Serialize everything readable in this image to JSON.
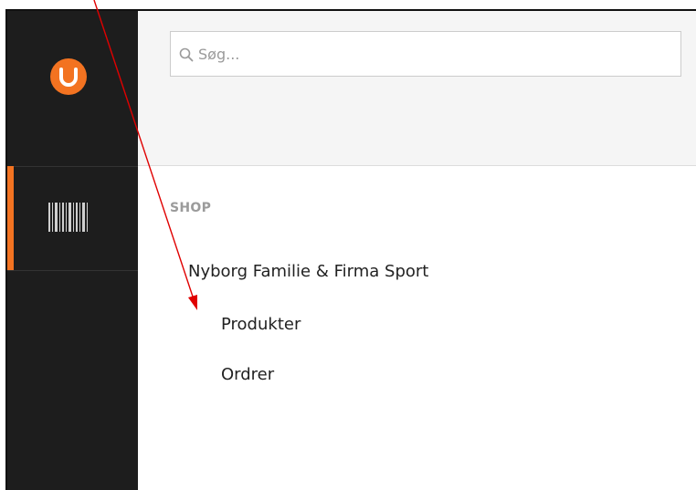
{
  "sidebar": {
    "logo_icon": "umbraco-logo-icon",
    "sections": [
      {
        "icon": "barcode-icon",
        "active": true
      }
    ]
  },
  "search": {
    "placeholder": "Søg...",
    "value": "",
    "icon": "search-icon"
  },
  "tree": {
    "section_title": "SHOP",
    "root_label": "Nyborg Familie & Firma Sport",
    "children": [
      {
        "label": "Produkter"
      },
      {
        "label": "Ordrer"
      }
    ]
  },
  "colors": {
    "accent": "#f37321",
    "sidebar_bg": "#1d1d1d",
    "annotation_arrow": "#e00000"
  }
}
